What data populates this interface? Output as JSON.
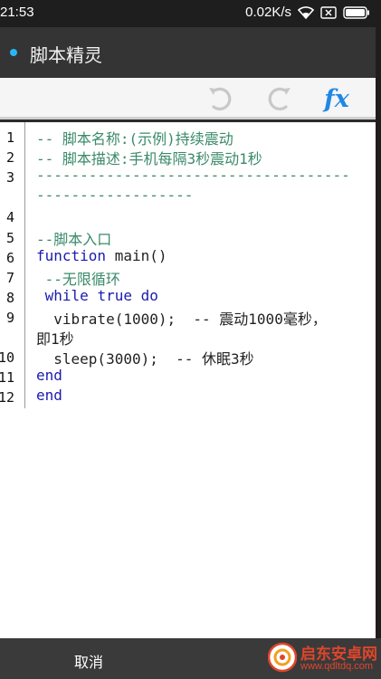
{
  "status": {
    "time": "21:53",
    "net_speed": "0.02K/s"
  },
  "app": {
    "title": "脚本精灵"
  },
  "toolbar": {
    "undo_icon": "undo-icon",
    "redo_icon": "redo-icon",
    "fx_label": "fx"
  },
  "code": {
    "line_numbers": [
      "1",
      "2",
      "3",
      "4",
      "5",
      "6",
      "7",
      "8",
      "9",
      "10",
      "11",
      "12"
    ],
    "lines": [
      "-- 脚本名称:(示例)持续震动",
      "-- 脚本描述:手机每隔3秒震动1秒",
      "------------------------------------",
      "------------------",
      "--脚本入口",
      "main()",
      " --无限循环",
      "true",
      "  vibrate(1000);  -- 震动1000毫秒，",
      "即1秒",
      "  sleep(3000);  -- 休眠3秒",
      "end",
      "end"
    ],
    "keywords": {
      "function": "function",
      "while": "while",
      "do": "do"
    }
  },
  "footer": {
    "cancel_label": "取消"
  },
  "watermark": {
    "name": "启东安卓网",
    "url": "www.qdltdq.com"
  },
  "colors": {
    "comment": "#3a8a6a",
    "keyword": "#1a1ab0",
    "accent": "#1e88e5"
  }
}
